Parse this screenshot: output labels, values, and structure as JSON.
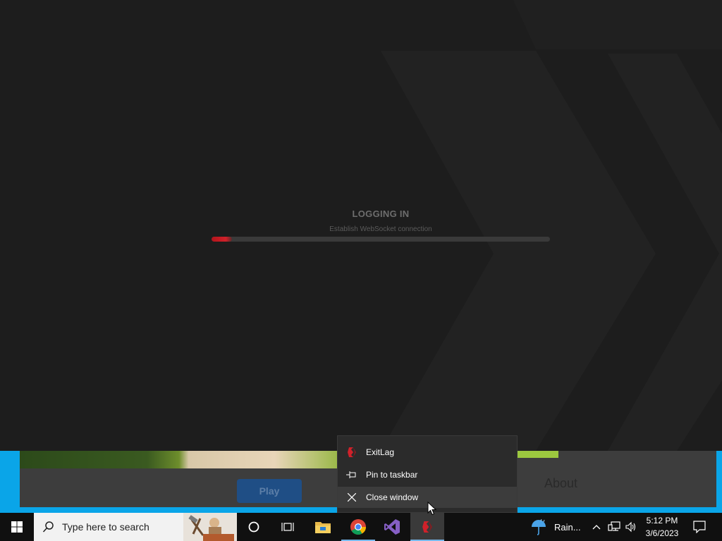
{
  "login": {
    "title": "LOGGING IN",
    "status": "Establish WebSocket connection",
    "progress_percent": 6
  },
  "background_window": {
    "play_label": "Play",
    "about_label": "About"
  },
  "jump_list": {
    "app_name": "ExitLag",
    "pin_label": "Pin to taskbar",
    "close_label": "Close window"
  },
  "taskbar": {
    "search_placeholder": "Type here to search",
    "weather_label": "Rain...",
    "time": "5:12 PM",
    "date": "3/6/2023",
    "pinned_apps": [
      "file-explorer",
      "chrome",
      "visual-studio",
      "exitlag"
    ]
  },
  "colors": {
    "accent_red": "#d0212a",
    "taskbar_bg": "#101010",
    "launcher_blue": "#0aa5e8",
    "active_indicator": "#76b9ed"
  }
}
